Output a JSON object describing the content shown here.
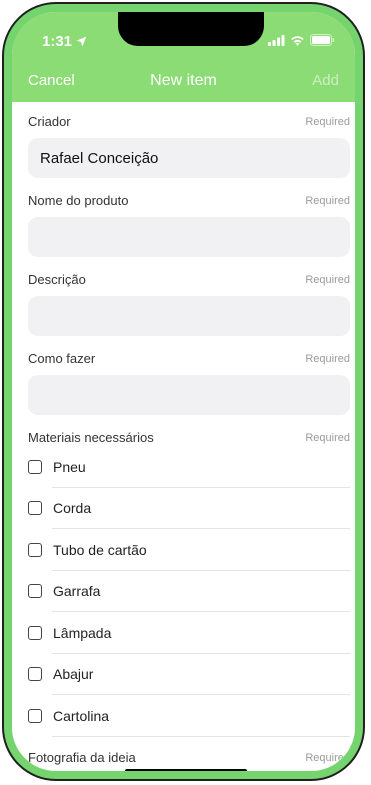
{
  "status_bar": {
    "time": "1:31"
  },
  "nav": {
    "cancel": "Cancel",
    "title": "New item",
    "add": "Add"
  },
  "fields": [
    {
      "label": "Criador",
      "required": "Required",
      "value": "Rafael Conceição"
    },
    {
      "label": "Nome do produto",
      "required": "Required",
      "value": ""
    },
    {
      "label": "Descrição",
      "required": "Required",
      "value": ""
    },
    {
      "label": "Como fazer",
      "required": "Required",
      "value": ""
    }
  ],
  "materials": {
    "label": "Materiais necessários",
    "required": "Required",
    "items": [
      {
        "label": "Pneu"
      },
      {
        "label": "Corda"
      },
      {
        "label": "Tubo de cartão"
      },
      {
        "label": "Garrafa"
      },
      {
        "label": "Lâmpada"
      },
      {
        "label": "Abajur"
      },
      {
        "label": "Cartolina"
      }
    ]
  },
  "photo": {
    "label": "Fotografia da ideia",
    "required": "Required"
  },
  "colors": {
    "header_green": "#8CDC75",
    "frame_green": "#76D46E",
    "input_bg": "#F1F1F3"
  }
}
